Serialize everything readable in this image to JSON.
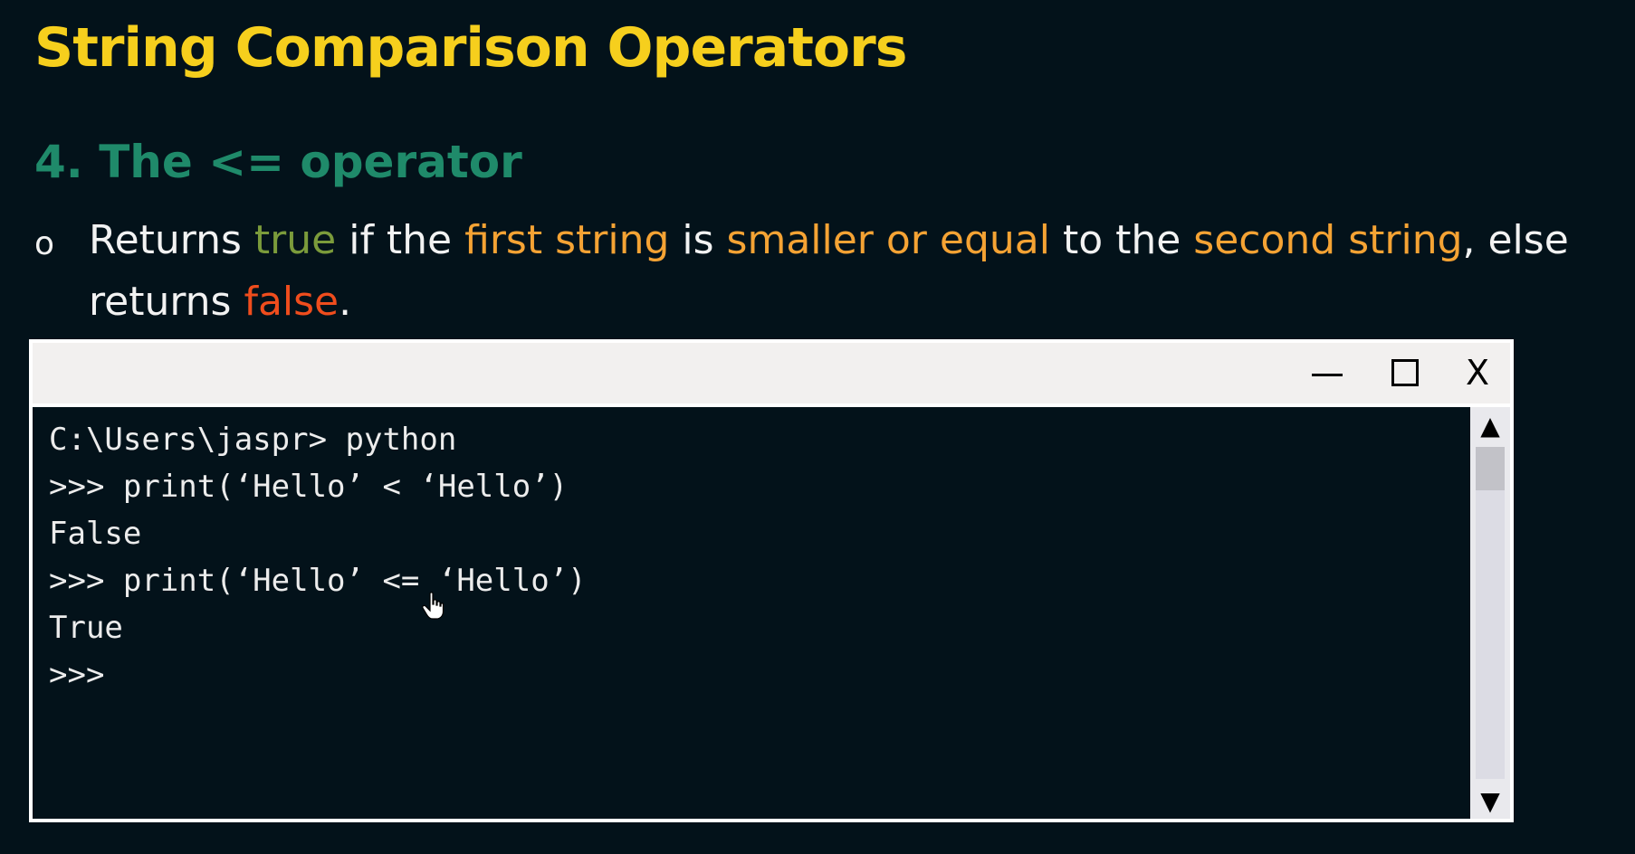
{
  "slide": {
    "title": "String Comparison Operators",
    "subtitle": "4. The <= operator",
    "bullet": {
      "mark": "o",
      "parts": [
        {
          "text": "Returns ",
          "style": "plain"
        },
        {
          "text": "true",
          "style": "true"
        },
        {
          "text": " if the ",
          "style": "plain"
        },
        {
          "text": "first string",
          "style": "hl"
        },
        {
          "text": " is ",
          "style": "plain"
        },
        {
          "text": "smaller or equal",
          "style": "hl"
        },
        {
          "text": " to the ",
          "style": "plain"
        },
        {
          "text": "second string",
          "style": "hl"
        },
        {
          "text": ", else returns ",
          "style": "plain"
        },
        {
          "text": "false",
          "style": "false"
        },
        {
          "text": ".",
          "style": "plain"
        }
      ]
    }
  },
  "window": {
    "controls": {
      "minimize_icon": "minimize-icon",
      "maximize_icon": "maximize-icon",
      "close_label": "X"
    },
    "console_lines": [
      "C:\\Users\\jaspr> python",
      ">>> print(‘Hello’ < ‘Hello’)",
      "False",
      ">>> print(‘Hello’ <= ‘Hello’)",
      "True",
      ">>>"
    ],
    "scrollbar": {
      "up_glyph": "▲",
      "down_glyph": "▼"
    }
  },
  "colors": {
    "background": "#03121a",
    "title": "#f6cf1d",
    "subtitle": "#1f8a6a",
    "true": "#7b9b3b",
    "highlight": "#f5a334",
    "false": "#f04d1d"
  }
}
